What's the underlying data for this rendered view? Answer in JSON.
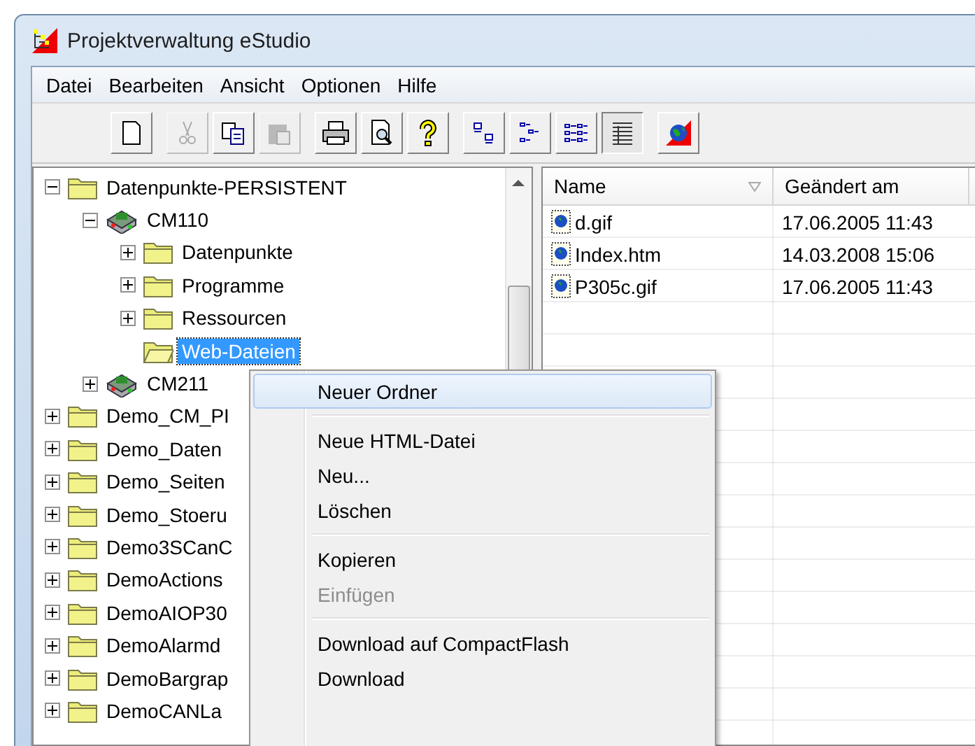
{
  "window": {
    "title": "Projektverwaltung eStudio"
  },
  "menu_bar": [
    "Datei",
    "Bearbeiten",
    "Ansicht",
    "Optionen",
    "Hilfe"
  ],
  "toolbar": [
    [
      {
        "kind": "new",
        "disabled": false,
        "selected": false
      }
    ],
    [
      {
        "kind": "cut",
        "disabled": true,
        "selected": false
      },
      {
        "kind": "copy",
        "disabled": false,
        "selected": false
      },
      {
        "kind": "paste",
        "disabled": true,
        "selected": false
      }
    ],
    [
      {
        "kind": "print",
        "disabled": false,
        "selected": false
      },
      {
        "kind": "preview",
        "disabled": false,
        "selected": false
      },
      {
        "kind": "help",
        "disabled": false,
        "selected": false
      }
    ],
    [
      {
        "kind": "large-icons",
        "disabled": false,
        "selected": false
      },
      {
        "kind": "small-icons",
        "disabled": false,
        "selected": false
      },
      {
        "kind": "list",
        "disabled": false,
        "selected": false
      },
      {
        "kind": "details",
        "disabled": false,
        "selected": true
      }
    ],
    [
      {
        "kind": "globe",
        "disabled": false,
        "selected": false
      }
    ]
  ],
  "tree": [
    {
      "label": "Datenpunkte-PERSISTENT",
      "kind": "folder",
      "expanded": true,
      "selected": false,
      "children": [
        {
          "label": "CM110",
          "kind": "device",
          "expanded": true,
          "selected": false,
          "children": [
            {
              "label": "Datenpunkte",
              "kind": "folder",
              "expanded": false,
              "selected": false
            },
            {
              "label": "Programme",
              "kind": "folder",
              "expanded": false,
              "selected": false
            },
            {
              "label": "Ressourcen",
              "kind": "folder",
              "expanded": false,
              "selected": false
            },
            {
              "label": "Web-Dateien",
              "kind": "open-folder",
              "selected": true
            }
          ]
        },
        {
          "label": "CM211",
          "kind": "device",
          "expanded": false,
          "selected": false
        }
      ]
    },
    {
      "label": "Demo_CM_PI",
      "kind": "folder",
      "expanded": false,
      "selected": false
    },
    {
      "label": "Demo_Daten",
      "kind": "folder",
      "expanded": false,
      "selected": false
    },
    {
      "label": "Demo_Seiten",
      "kind": "folder",
      "expanded": false,
      "selected": false
    },
    {
      "label": "Demo_Stoeru",
      "kind": "folder",
      "expanded": false,
      "selected": false
    },
    {
      "label": "Demo3SCanC",
      "kind": "folder",
      "expanded": false,
      "selected": false
    },
    {
      "label": "DemoActions",
      "kind": "folder",
      "expanded": false,
      "selected": false
    },
    {
      "label": "DemoAIOP30",
      "kind": "folder",
      "expanded": false,
      "selected": false
    },
    {
      "label": "DemoAlarmd",
      "kind": "folder",
      "expanded": false,
      "selected": false
    },
    {
      "label": "DemoBargrap",
      "kind": "folder",
      "expanded": false,
      "selected": false
    },
    {
      "label": "DemoCANLa",
      "kind": "folder",
      "expanded": false,
      "selected": false
    }
  ],
  "file_list": {
    "columns": [
      "Name",
      "Geändert am"
    ],
    "rows": [
      {
        "name": "d.gif",
        "modified": "17.06.2005 11:43"
      },
      {
        "name": "Index.htm",
        "modified": "14.03.2008 15:06"
      },
      {
        "name": "P305c.gif",
        "modified": "17.06.2005 11:43"
      }
    ]
  },
  "context_menu": [
    {
      "kind": "item",
      "label": "Neuer Ordner",
      "selected": true,
      "disabled": false
    },
    {
      "kind": "separator"
    },
    {
      "kind": "item",
      "label": "Neue HTML-Datei",
      "selected": false,
      "disabled": false
    },
    {
      "kind": "item",
      "label": "Neu...",
      "selected": false,
      "disabled": false
    },
    {
      "kind": "item",
      "label": "Löschen",
      "selected": false,
      "disabled": false
    },
    {
      "kind": "separator"
    },
    {
      "kind": "item",
      "label": "Kopieren",
      "selected": false,
      "disabled": false
    },
    {
      "kind": "item",
      "label": "Einfügen",
      "selected": false,
      "disabled": true
    },
    {
      "kind": "separator"
    },
    {
      "kind": "item",
      "label": "Download auf CompactFlash",
      "selected": false,
      "disabled": false
    },
    {
      "kind": "item",
      "label": "Download",
      "selected": false,
      "disabled": false
    }
  ]
}
